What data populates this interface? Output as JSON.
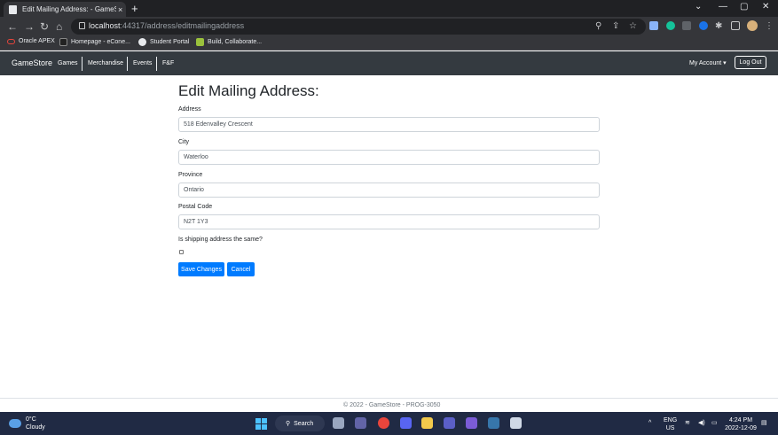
{
  "browser": {
    "tab_title": "Edit Mailing Address: - GameSto",
    "tab_close": "×",
    "new_tab": "+",
    "url_host": "localhost",
    "url_path": ":44317/address/editmailingaddress",
    "controls": [
      "⌄",
      "—",
      "▢",
      "✕"
    ]
  },
  "bookmarks": [
    {
      "label": "Oracle APEX",
      "color": "#e8453c"
    },
    {
      "label": "Homepage - eCone...",
      "color": "#222222"
    },
    {
      "label": "Student Portal",
      "color": "#e8eaed"
    },
    {
      "label": "Build, Collaborate...",
      "color": "#9bc23c"
    }
  ],
  "navbar": {
    "brand": "GameStore",
    "links": [
      "Games",
      "Merchandise",
      "Events",
      "F&F"
    ],
    "account": "My Account ▾",
    "logout": "Log Out"
  },
  "form": {
    "title": "Edit Mailing Address:",
    "address_label": "Address",
    "address_value": "518 Edenvalley Crescent",
    "city_label": "City",
    "city_value": "Waterloo",
    "province_label": "Province",
    "province_value": "Ontario",
    "postal_label": "Postal Code",
    "postal_value": "N2T 1Y3",
    "shipping_question": "Is shipping address the same?",
    "shipping_checked": false,
    "save_label": "Save Changes",
    "cancel_label": "Cancel"
  },
  "footer": {
    "text": "© 2022 - GameStore - PROG-3050"
  },
  "taskbar": {
    "temp": "0°C",
    "condition": "Cloudy",
    "search_label": "Search",
    "lang_top": "ENG",
    "lang_bottom": "US",
    "time": "4:24 PM",
    "date": "2022-12-09"
  }
}
